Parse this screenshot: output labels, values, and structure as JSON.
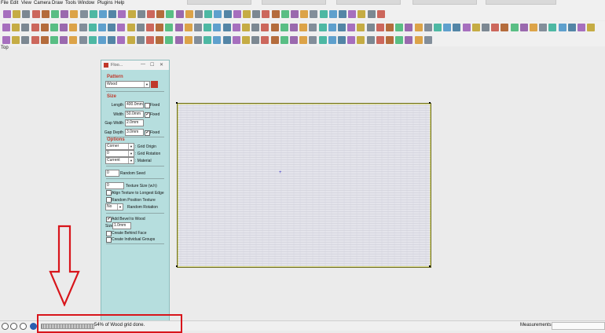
{
  "menu": [
    "File",
    "Edit",
    "View",
    "Camera",
    "Draw",
    "Tools",
    "Window",
    "Plugins",
    "Help"
  ],
  "scene_label": "Top",
  "panel": {
    "title": "Floo...",
    "controls": [
      "—",
      "☐",
      "✕"
    ],
    "pattern_header": "Pattern",
    "pattern_value": "Wood",
    "size_header": "Size",
    "length_label": "Length",
    "length_value": "400.0mm",
    "length_fixed_label": "Fixed",
    "length_fixed": false,
    "width_label": "Width",
    "width_value": "50.0mm",
    "width_fixed_label": "Fixed",
    "width_fixed": true,
    "gapwidth_label": "Gap Width",
    "gapwidth_value": "2.0mm",
    "gapdepth_label": "Gap Depth",
    "gapdepth_value": "3.0mm",
    "gapdepth_fixed_label": "Fixed",
    "gapdepth_fixed": true,
    "options_header": "Options",
    "grid_origin_value": "Corner",
    "grid_origin_label": ": Grid Origin",
    "grid_rotation_value": "0",
    "grid_rotation_label": ": Grid Rotation",
    "material_value": "Current",
    "material_label": ": Material",
    "random_seed_value": "0",
    "random_seed_label": "Random Seed",
    "texture_size_value": "0",
    "texture_size_label": "Texture Size (w.h)",
    "align_texture_label": "Align Texture to Longest Edge",
    "random_position_label": "Random Position Texture",
    "random_rotation_value": "No",
    "random_rotation_label": "Random Rotation",
    "bevel_label": "Add Bevel to Wood",
    "bevel_checked": true,
    "bevel_size_label": "Size",
    "bevel_size_value": "1.0mm",
    "create_behind_label": "Create Behind Face",
    "create_groups_label": "Create Individual Groups"
  },
  "status": {
    "progress_text": "54% of Wood grid done.",
    "progress": 0.54,
    "measurements_label": "Measurements"
  },
  "colors": {
    "annotation_red": "#d8151b",
    "panel_bg": "#b6dede",
    "section_red": "#c0392b"
  }
}
